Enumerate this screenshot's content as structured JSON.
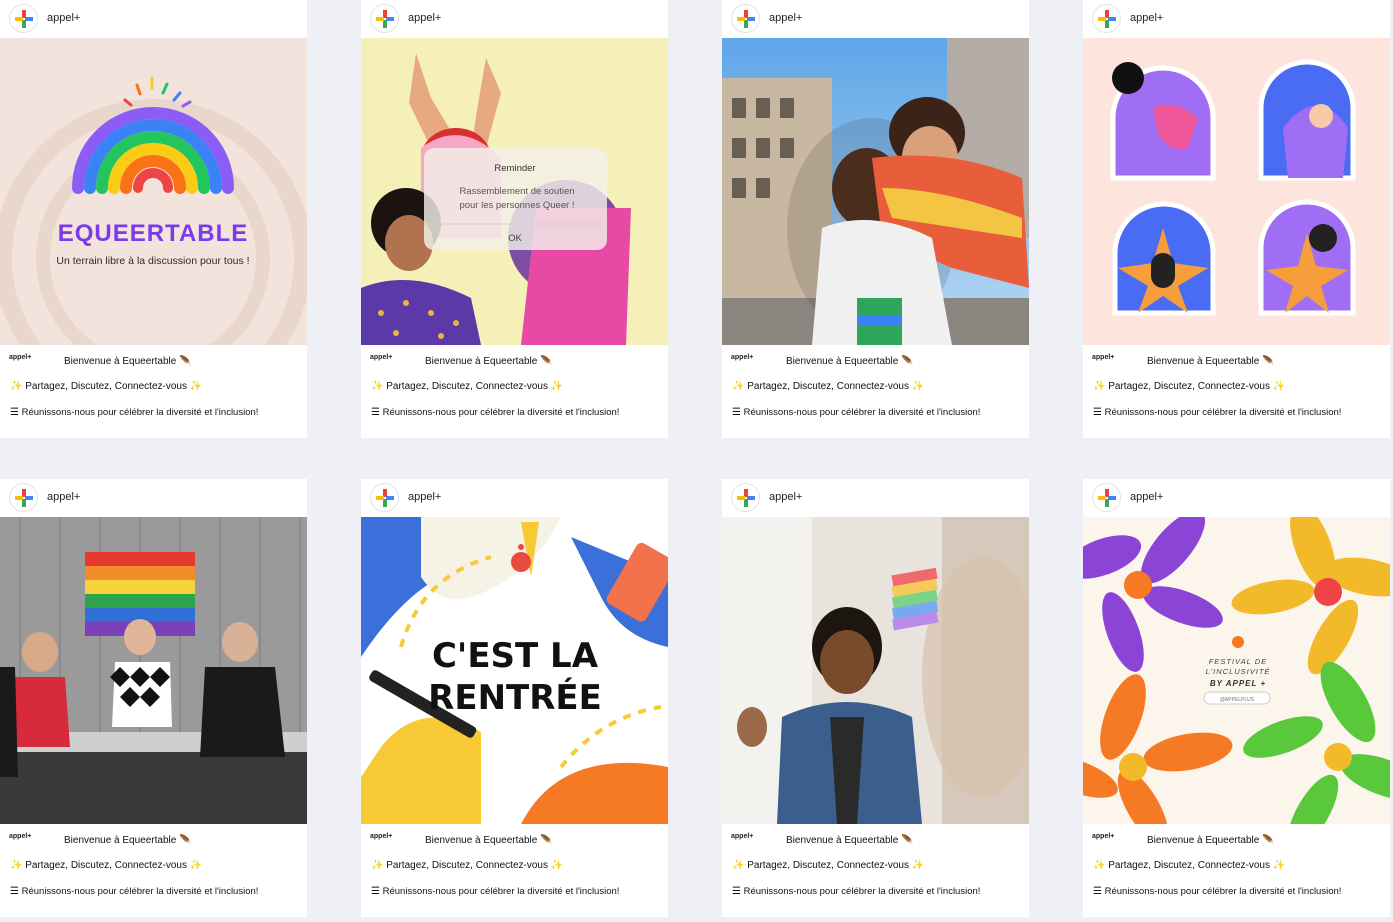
{
  "posts": [
    {
      "account": "appel+",
      "tiny_brand": "appel+",
      "welcome": "Bienvenue à  Equeertable",
      "welcome_icon": "feather-icon",
      "line2": "Partagez, Discutez, Connectez-vous",
      "line3": "Réunissons-nous pour célébrer la diversité et l'inclusion!",
      "image": {
        "title": "EQUEERTABLE",
        "subtitle": "Un terrain libre à la discussion pour tous !"
      }
    },
    {
      "account": "appel+",
      "tiny_brand": "appel+",
      "welcome": "Bienvenue à  Equeertable",
      "welcome_icon": "feather-icon",
      "line2": "Partagez, Discutez, Connectez-vous",
      "line3": "Réunissons-nous pour célébrer la diversité et l'inclusion!",
      "image": {
        "dialog_title": "Reminder",
        "dialog_body_1": "Rassemblement de soutien",
        "dialog_body_2": "pour les personnes Queer !",
        "dialog_button": "OK"
      }
    },
    {
      "account": "appel+",
      "tiny_brand": "appel+",
      "welcome": "Bienvenue à  Equeertable",
      "welcome_icon": "feather-icon",
      "line2": "Partagez, Discutez, Connectez-vous",
      "line3": "Réunissons-nous pour célébrer la diversité et l'inclusion!"
    },
    {
      "account": "appel+",
      "tiny_brand": "appel+",
      "welcome": "Bienvenue à  Equeertable",
      "welcome_icon": "feather-icon",
      "line2": "Partagez, Discutez, Connectez-vous",
      "line3": "Réunissons-nous pour célébrer la diversité et l'inclusion!"
    },
    {
      "account": "appel+",
      "tiny_brand": "appel+",
      "welcome": "Bienvenue à  Equeertable",
      "welcome_icon": "feather-icon",
      "line2": "Partagez, Discutez, Connectez-vous",
      "line3": "Réunissons-nous pour célébrer la diversité et l'inclusion!"
    },
    {
      "account": "appel+",
      "tiny_brand": "appel+",
      "welcome": "Bienvenue à  Equeertable",
      "welcome_icon": "feather-icon",
      "line2": "Partagez, Discutez, Connectez-vous",
      "line3": "Réunissons-nous pour célébrer la diversité et l'inclusion!",
      "image": {
        "headline_1": "C'EST LA",
        "headline_2": "RENTRÉE"
      }
    },
    {
      "account": "appel+",
      "tiny_brand": "appel+",
      "welcome": "Bienvenue à  Equeertable",
      "welcome_icon": "feather-icon",
      "line2": "Partagez, Discutez, Connectez-vous",
      "line3": "Réunissons-nous pour célébrer la diversité et l'inclusion!"
    },
    {
      "account": "appel+",
      "tiny_brand": "appel+",
      "welcome": "Bienvenue à  Equeertable",
      "welcome_icon": "feather-icon",
      "line2": "Partagez, Discutez, Connectez-vous",
      "line3": "Réunissons-nous pour célébrer la diversité et l'inclusion!",
      "image": {
        "line_1": "FESTIVAL DE",
        "line_2": "L'INCLUSIVITÉ",
        "line_3": "BY APPEL +",
        "handle": "@APPELPLUS"
      }
    }
  ],
  "glyphs": {
    "sparkle": "✨",
    "menu": "☰",
    "feather": "🪶"
  },
  "colors": {
    "page_bg": "#eef0f5",
    "card_bg": "#ffffff",
    "logo_red": "#ea4335",
    "logo_blue": "#4285f4",
    "logo_yellow": "#fbbc05",
    "logo_green": "#34a853"
  }
}
